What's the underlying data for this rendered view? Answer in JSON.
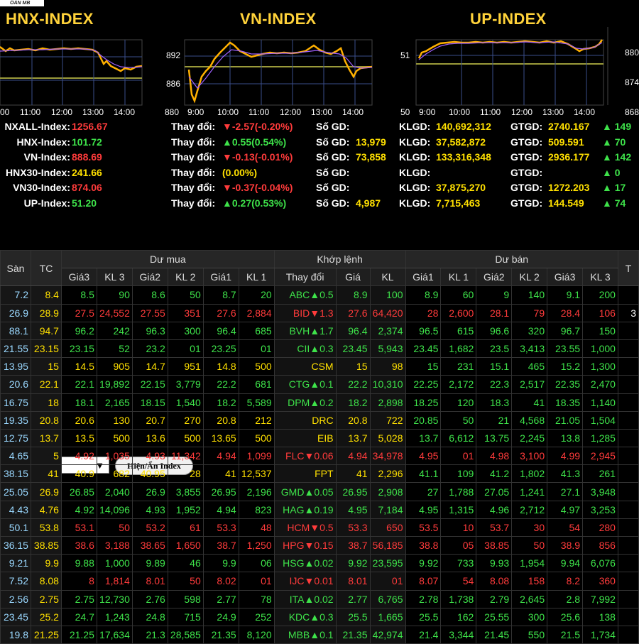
{
  "logo_text": "ÔÁN MB",
  "indices": [
    {
      "title": "HNX-INDEX",
      "y_ticks": [],
      "x_ticks": [
        "00",
        "11:00",
        "12:00",
        "13:00",
        "14:00"
      ]
    },
    {
      "title": "VN-INDEX",
      "y_ticks": [
        "892",
        "886",
        "880"
      ],
      "x_ticks": [
        "9:00",
        "10:00",
        "11:00",
        "12:00",
        "13:00",
        "14:00"
      ]
    },
    {
      "title": "UP-INDEX",
      "y_ticks": [
        "51",
        "50"
      ],
      "x_ticks": [
        "9:00",
        "10:00",
        "11:00",
        "12:00",
        "13:00",
        "14:00"
      ]
    }
  ],
  "right_ticks": [
    "880",
    "874",
    "868"
  ],
  "summary": [
    {
      "name": "NXALL-Index:",
      "value": "1256.67",
      "vcolor": "r",
      "change": "▼-2.57(-0.20%)",
      "ccolor": "r",
      "sogd": "",
      "klgd": "140,692,312",
      "gtgd": "2740.167",
      "adv": "▲ 149"
    },
    {
      "name": "HNX-Index:",
      "value": "101.72",
      "vcolor": "g",
      "change": "▲0.55(0.54%)",
      "ccolor": "g",
      "sogd": "13,979",
      "klgd": "37,582,872",
      "gtgd": "509.591",
      "adv": "▲ 70"
    },
    {
      "name": "VN-Index:",
      "value": "888.69",
      "vcolor": "r",
      "change": "▼-0.13(-0.01%)",
      "ccolor": "r",
      "sogd": "73,858",
      "klgd": "133,316,348",
      "gtgd": "2936.177",
      "adv": "▲ 142"
    },
    {
      "name": "HNX30-Index:",
      "value": "241.66",
      "vcolor": "y",
      "change": "(0.00%)",
      "ccolor": "y",
      "sogd": "",
      "klgd": "",
      "gtgd": "",
      "adv": "▲ 0"
    },
    {
      "name": "VN30-Index:",
      "value": "874.06",
      "vcolor": "r",
      "change": "▼-0.37(-0.04%)",
      "ccolor": "r",
      "sogd": "",
      "klgd": "37,875,270",
      "gtgd": "1272.203",
      "adv": "▲ 17"
    },
    {
      "name": "UP-Index:",
      "value": "51.20",
      "vcolor": "g",
      "change": "▲0.27(0.53%)",
      "ccolor": "g",
      "sogd": "4,987",
      "klgd": "7,715,463",
      "gtgd": "144.549",
      "adv": "▲ 74"
    }
  ],
  "labels": {
    "thaydoi": "Thay đổi:",
    "sogd": "Số GD:",
    "klgd": "KLGD:",
    "gtgd": "GTGD:"
  },
  "toggle_label": "Hiện/Ẩn Index",
  "table": {
    "group_headers": {
      "san": "Sàn",
      "tc": "TC",
      "du_mua": "Dư mua",
      "khop": "Khớp lệnh",
      "du_ban": "Dư bán",
      "extra": "T"
    },
    "sub_headers": [
      "Giá3",
      "KL 3",
      "Giá2",
      "KL 2",
      "Giá1",
      "KL 1",
      "Thay đổi",
      "Giá",
      "KL",
      "Giá1",
      "KL 1",
      "Giá2",
      "KL 2",
      "Giá3",
      "KL 3"
    ],
    "rows": [
      {
        "c": "g",
        "cells": [
          "7.2",
          "8.4",
          "8.5",
          "90",
          "8.6",
          "50",
          "8.7",
          "20",
          "ABC▲0.5",
          "8.9",
          "100",
          "8.9",
          "60",
          "9",
          "140",
          "9.1",
          "200",
          ""
        ]
      },
      {
        "c": "r",
        "cells": [
          "26.9",
          "28.9",
          "27.5",
          "24,552",
          "27.55",
          "351",
          "27.6",
          "2,884",
          "BID▼1.3",
          "27.6",
          "64,420",
          "28",
          "2,600",
          "28.1",
          "79",
          "28.4",
          "106",
          "3"
        ]
      },
      {
        "c": "g",
        "cells": [
          "88.1",
          "94.7",
          "96.2",
          "242",
          "96.3",
          "300",
          "96.4",
          "685",
          "BVH▲1.7",
          "96.4",
          "2,374",
          "96.5",
          "615",
          "96.6",
          "320",
          "96.7",
          "150",
          ""
        ]
      },
      {
        "c": "g",
        "cells": [
          "21.55",
          "23.15",
          "23.15",
          "52",
          "23.2",
          "01",
          "23.25",
          "01",
          "CII▲0.3",
          "23.45",
          "5,943",
          "23.45",
          "1,682",
          "23.5",
          "3,413",
          "23.55",
          "1,000",
          ""
        ]
      },
      {
        "c": "y",
        "cells": [
          "13.95",
          "15",
          "14.5",
          "905",
          "14.7",
          "951",
          "14.8",
          "500",
          "CSM",
          "15",
          "98",
          "15",
          "231",
          "15.1",
          "465",
          "15.2",
          "1,300",
          ""
        ]
      },
      {
        "c": "g",
        "cells": [
          "20.6",
          "22.1",
          "22.1",
          "19,892",
          "22.15",
          "3,779",
          "22.2",
          "681",
          "CTG▲0.1",
          "22.2",
          "10,310",
          "22.25",
          "2,172",
          "22.3",
          "2,517",
          "22.35",
          "2,470",
          ""
        ]
      },
      {
        "c": "g",
        "cells": [
          "16.75",
          "18",
          "18.1",
          "2,165",
          "18.15",
          "1,540",
          "18.2",
          "5,589",
          "DPM▲0.2",
          "18.2",
          "2,898",
          "18.25",
          "120",
          "18.3",
          "41",
          "18.35",
          "1,140",
          ""
        ]
      },
      {
        "c": "y",
        "cells": [
          "19.35",
          "20.8",
          "20.6",
          "130",
          "20.7",
          "270",
          "20.8",
          "212",
          "DRC",
          "20.8",
          "722",
          "20.85",
          "50",
          "21",
          "4,568",
          "21.05",
          "1,504",
          ""
        ]
      },
      {
        "c": "y",
        "cells": [
          "12.75",
          "13.7",
          "13.5",
          "500",
          "13.6",
          "500",
          "13.65",
          "500",
          "EIB",
          "13.7",
          "5,028",
          "13.7",
          "6,612",
          "13.75",
          "2,245",
          "13.8",
          "1,285",
          ""
        ]
      },
      {
        "c": "r",
        "cells": [
          "4.65",
          "5",
          "4.92",
          "1,035",
          "4.93",
          "11,342",
          "4.94",
          "1,099",
          "FLC▼0.06",
          "4.94",
          "34,978",
          "4.95",
          "01",
          "4.98",
          "3,100",
          "4.99",
          "2,945",
          ""
        ]
      },
      {
        "c": "y",
        "cells": [
          "38.15",
          "41",
          "40.9",
          "682",
          "40.95",
          "28",
          "41",
          "12,537",
          "FPT",
          "41",
          "2,296",
          "41.1",
          "109",
          "41.2",
          "1,802",
          "41.3",
          "261",
          ""
        ]
      },
      {
        "c": "g",
        "cells": [
          "25.05",
          "26.9",
          "26.85",
          "2,040",
          "26.9",
          "3,855",
          "26.95",
          "2,196",
          "GMD▲0.05",
          "26.95",
          "2,908",
          "27",
          "1,788",
          "27.05",
          "1,241",
          "27.1",
          "3,948",
          ""
        ]
      },
      {
        "c": "g",
        "cells": [
          "4.43",
          "4.76",
          "4.92",
          "14,096",
          "4.93",
          "1,952",
          "4.94",
          "823",
          "HAG▲0.19",
          "4.95",
          "7,184",
          "4.95",
          "1,315",
          "4.96",
          "2,712",
          "4.97",
          "3,253",
          ""
        ]
      },
      {
        "c": "r",
        "cells": [
          "50.1",
          "53.8",
          "53.1",
          "50",
          "53.2",
          "61",
          "53.3",
          "48",
          "HCM▼0.5",
          "53.3",
          "650",
          "53.5",
          "10",
          "53.7",
          "30",
          "54",
          "280",
          ""
        ]
      },
      {
        "c": "r",
        "cells": [
          "36.15",
          "38.85",
          "38.6",
          "3,188",
          "38.65",
          "1,650",
          "38.7",
          "1,250",
          "HPG▼0.15",
          "38.7",
          "56,185",
          "38.8",
          "05",
          "38.85",
          "50",
          "38.9",
          "856",
          ""
        ]
      },
      {
        "c": "g",
        "cells": [
          "9.21",
          "9.9",
          "9.88",
          "1,000",
          "9.89",
          "46",
          "9.9",
          "06",
          "HSG▲0.02",
          "9.92",
          "23,595",
          "9.92",
          "733",
          "9.93",
          "1,954",
          "9.94",
          "6,076",
          ""
        ]
      },
      {
        "c": "r",
        "cells": [
          "7.52",
          "8.08",
          "8",
          "1,814",
          "8.01",
          "50",
          "8.02",
          "01",
          "IJC▼0.01",
          "8.01",
          "01",
          "8.07",
          "54",
          "8.08",
          "158",
          "8.2",
          "360",
          ""
        ]
      },
      {
        "c": "g",
        "cells": [
          "2.56",
          "2.75",
          "2.75",
          "12,730",
          "2.76",
          "598",
          "2.77",
          "78",
          "ITA▲0.02",
          "2.77",
          "6,765",
          "2.78",
          "1,738",
          "2.79",
          "2,645",
          "2.8",
          "7,992",
          ""
        ]
      },
      {
        "c": "g",
        "cells": [
          "23.45",
          "25.2",
          "24.7",
          "1,243",
          "24.8",
          "715",
          "24.9",
          "252",
          "KDC▲0.3",
          "25.5",
          "1,665",
          "25.5",
          "162",
          "25.55",
          "300",
          "25.6",
          "138",
          ""
        ]
      },
      {
        "c": "g",
        "cells": [
          "19.8",
          "21.25",
          "21.25",
          "17,634",
          "21.3",
          "28,585",
          "21.35",
          "8,120",
          "MBB▲0.1",
          "21.35",
          "42,974",
          "21.4",
          "3,344",
          "21.45",
          "550",
          "21.5",
          "1,734",
          ""
        ]
      }
    ]
  },
  "colors": {
    "green": "#3ee34a",
    "red": "#ff3b3b",
    "yellow": "#ffe000",
    "title": "#ffd23a"
  }
}
